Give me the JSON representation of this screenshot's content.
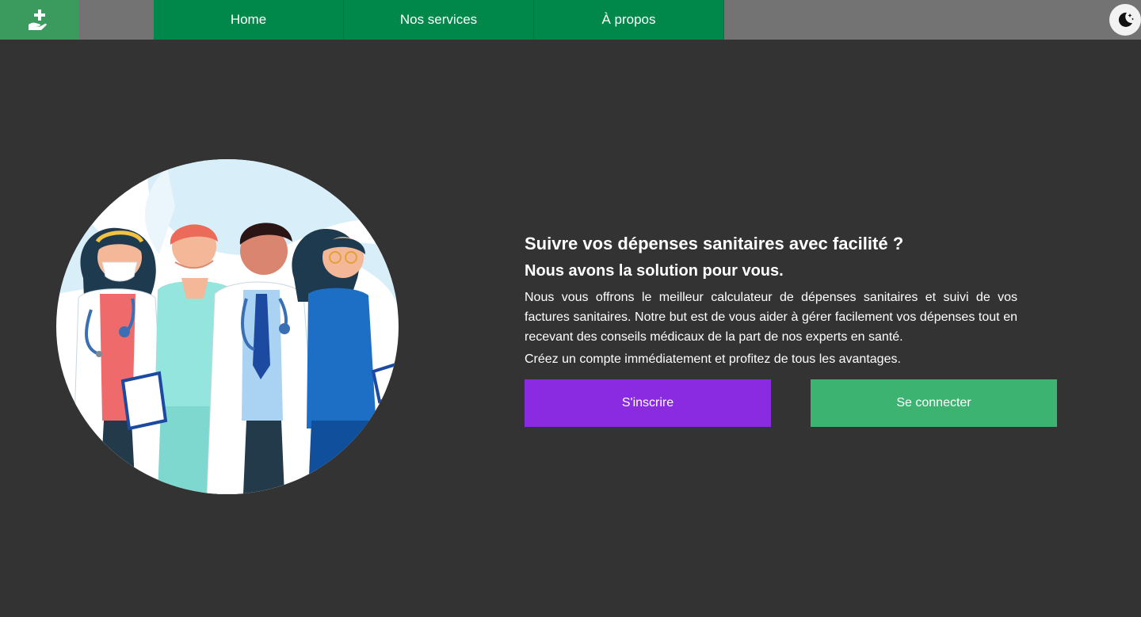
{
  "header": {
    "logo_icon": "hand-holding-medical-icon",
    "nav": [
      {
        "label": "Home"
      },
      {
        "label": "Nos services"
      },
      {
        "label": "À propos"
      }
    ],
    "theme_toggle_icon": "moon-stars-icon"
  },
  "hero": {
    "illustration": "medical-team-illustration",
    "headline": "Suivre vos dépenses sanitaires avec facilité ?",
    "subheadline": "Nous avons la solution pour vous.",
    "description": "Nous vous offrons le meilleur calculateur de dépenses sanitaires et suivi de vos factures sanitaires. Notre but est de vous aider à gérer facilement vos dépenses tout en recevant des conseils médicaux de la part de nos experts en santé.",
    "cta_text": "Créez un compte immédiatement et profitez de tous les avantages.",
    "signup_label": "S'inscrire",
    "login_label": "Se connecter"
  },
  "colors": {
    "background": "#333333",
    "navbar": "#737373",
    "nav_link": "#00874a",
    "logo_box": "#3b9a5d",
    "signup_button": "#8a2be2",
    "login_button": "#3cb371"
  }
}
